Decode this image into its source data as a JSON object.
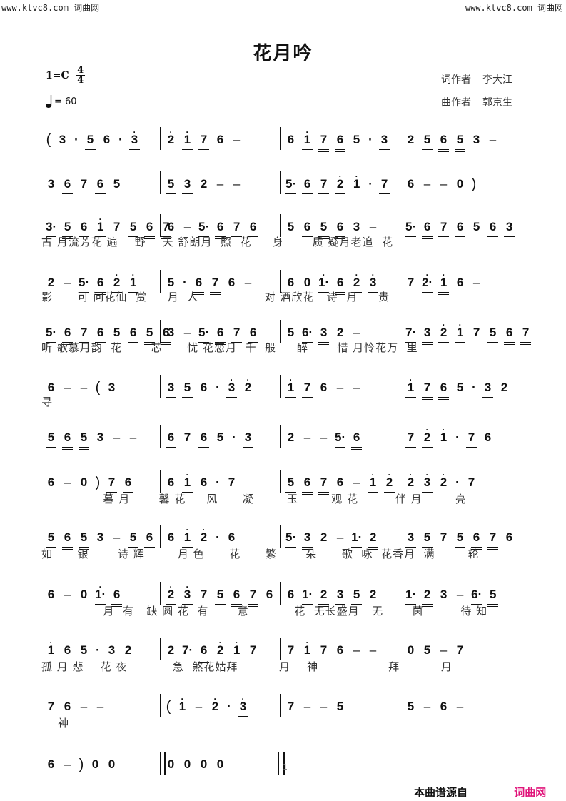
{
  "watermark": {
    "left": "www.ktvc8.com 词曲网",
    "right": "www.ktvc8.com 词曲网"
  },
  "title": "花月吟",
  "key": {
    "label": "1=C",
    "time_top": "4",
    "time_bottom": "4"
  },
  "tempo": {
    "icon": "quarter-note-icon",
    "value": "= 60"
  },
  "credits": {
    "lyricist_label": "词作者",
    "lyricist": "李大江",
    "composer_label": "曲作者",
    "composer": "郭京生"
  },
  "rows": [
    {
      "measures": [
        "( 3 · 5_ 6 · 3'_",
        "2' 1'_ 7_ 6 –",
        "6 1'_ 7__ 6__ 5 · 3_",
        "2 5_ 6__ 5__ 3 –"
      ]
    },
    {
      "measures": [
        "3 6_ 7 6_ 5",
        "5_ 3_ 2 – –",
        "5·_ 6__ 7_ 2'_ 1' · 7_",
        "6 – – 0 )"
      ]
    },
    {
      "measures": [
        "3·_ 5__ 6_ 1'_ 7 5_ 6__ 7__",
        "6 – 5·_ 6__ 7_ 6_",
        "5 6_ 5__ 6__ 3 –",
        "5·_ 6__ 7_ 6_ 5 6_ 3_"
      ]
    },
    {
      "measures": [
        "2 – 5·_ 6__ 2'_ 1'_",
        "5 · 6__ 7__ 6 –",
        "6 0 1'·_ 6__ 2'_ 3'_",
        "7 2'·_ 1'__ 6 –"
      ]
    },
    {
      "measures": [
        "5·_ 6__ 7_ 6_ 5 6_ 5__ 6__",
        "3 – 5·_ 6__ 7_ 6_",
        "5 6·_ 3__ 2 –",
        "7·_ 3__ 2'_ 1'_ 7 5_ 6__ 7__"
      ]
    },
    {
      "measures": [
        "6 – – ( 3",
        "3_ 5_ 6 · 3'_ 2'",
        "1'_ 7_ 6 – –",
        "1'_ 7__ 6__ 5 · 3_ 2"
      ]
    },
    {
      "measures": [
        "5_ 6__ 5__ 3 – –",
        "6_ 7 6_ 5 · 3_",
        "2 – – 5·_ 6__",
        "7_ 2'_ 1' · 7_ 6"
      ]
    },
    {
      "measures": [
        "6 – 0 ) 7_ 6_",
        "6 1'_ 6 · 7",
        "5_ 6__ 7__ 6 – 1'_ 2'_",
        "2' 3'_ 2' · 7"
      ]
    },
    {
      "measures": [
        "5_ 6__ 5__ 3 – 5_ 6_",
        "6 1'_ 2' · 6",
        "5·_ 3__ 2 – 1·_ 2__",
        "3_ 5_ 7 5_ 6__ 7__ 6"
      ]
    },
    {
      "measures": [
        "6 – 0 1'·_ 6__",
        "2'_ 3'_ 7 5_ 6__ 7__ 6",
        "6 1·_ 2__ 3_ 5_ 2",
        "1·_ 2__ 3 – 6·_ 5__"
      ]
    },
    {
      "measures": [
        "1'_ 6_ 5 · 3_ 2",
        "2 7·_ 6__ 2'_ 1'_ 7",
        "7_ 1'_ 7_ 6 – –",
        "0 5 – 7"
      ]
    },
    {
      "measures": [
        "7 6 – –",
        "( 1' – 2' · 3'_",
        "7 – – 5",
        "5 – 6 –"
      ]
    },
    {
      "measures": [
        "6 – ) 0 0",
        "0 0 0 0"
      ]
    }
  ],
  "lyrics": [
    "",
    "",
    "古 月流芳花 遍    野    天 舒朗月  照  花     身       质 疑月老追  花",
    "影      可 问花仙  赏     月  人                对 酒欣花   诗  月     贵",
    "听 歌慕月韵  花       芯      忧 花恋月  千  般     醉       惜 月怜花万  里",
    "寻",
    "",
    "               暮 月       馨 花     风      凝        玉        观 花         伴 月        亮",
    "如      银       诗 辉        月 色      花      繁       朵      歌  咏  花香月  满        轮",
    "               月  有   缺 圆 花  有       意           花  无长盛月   无       茵         待 知",
    "孤 月 悲    花 夜           急  煞花姑拜          月    神                 拜          月",
    "    神",
    ""
  ],
  "page_number": "1",
  "footer": {
    "source_label": "本曲谱源自",
    "source_site": "词曲网",
    "accent_color": "#e0147a"
  }
}
